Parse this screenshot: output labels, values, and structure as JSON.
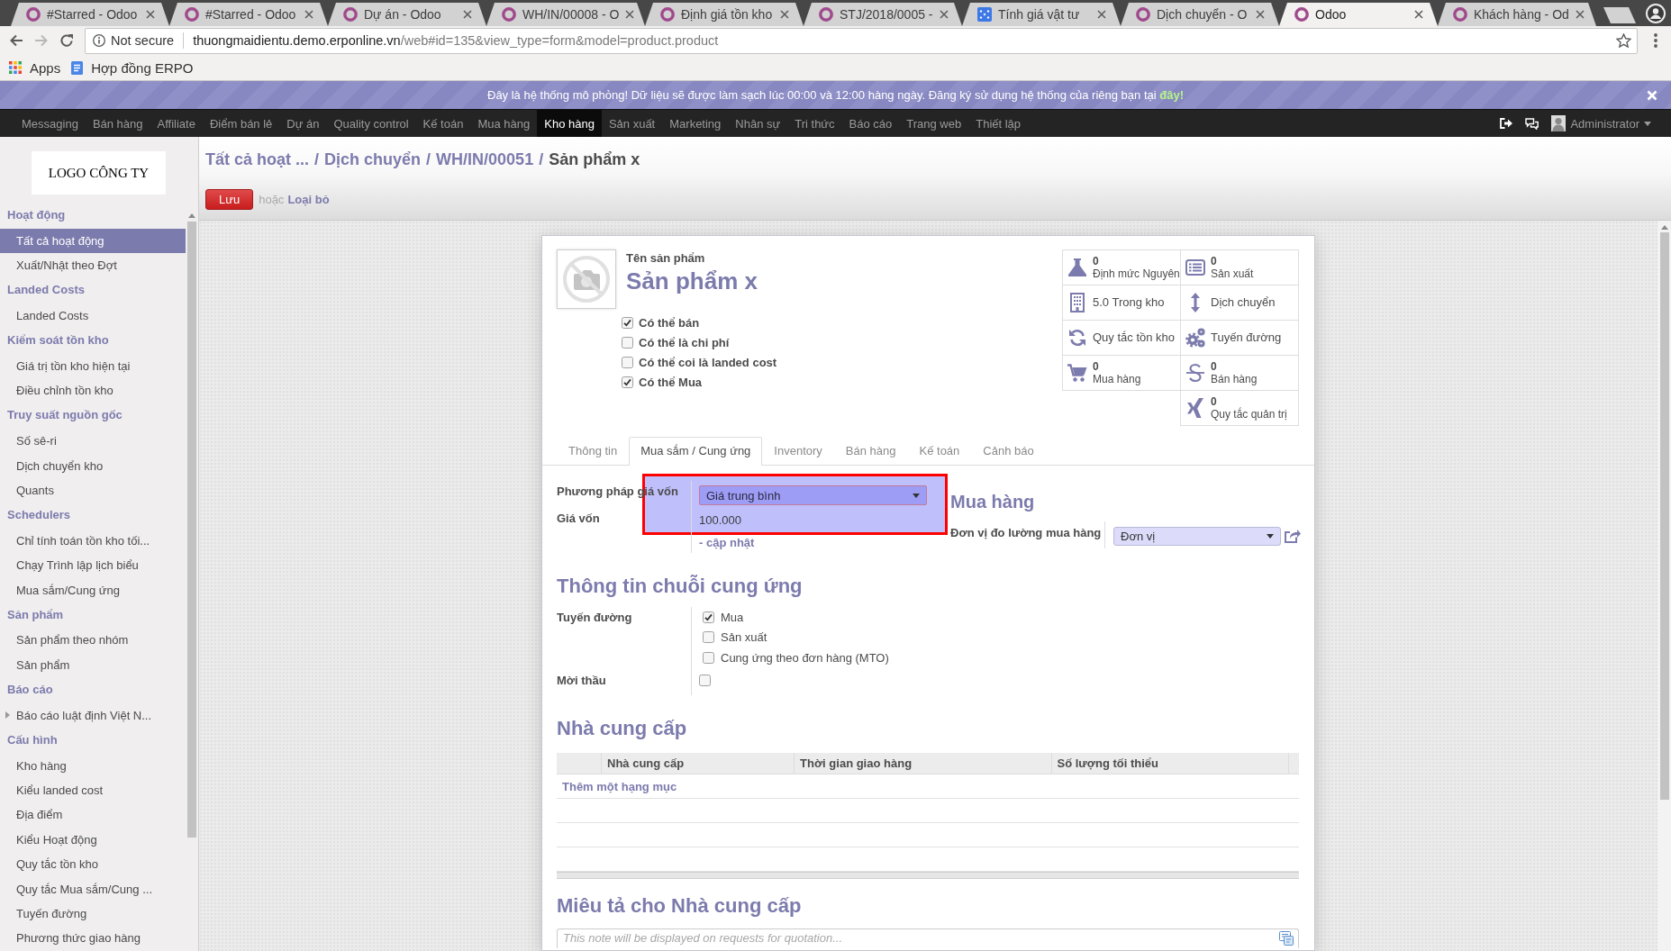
{
  "browser": {
    "tabs": [
      {
        "title": "#Starred - Odoo",
        "kind": "app",
        "selected": false
      },
      {
        "title": "#Starred - Odoo",
        "kind": "app",
        "selected": false
      },
      {
        "title": "Dự án - Odoo",
        "kind": "app",
        "selected": false
      },
      {
        "title": "WH/IN/00008 - O",
        "kind": "app",
        "selected": false
      },
      {
        "title": "Định giá tồn kho",
        "kind": "app",
        "selected": false
      },
      {
        "title": "STJ/2018/0005 -",
        "kind": "app",
        "selected": false
      },
      {
        "title": "Tính giá vật tư",
        "kind": "tool",
        "selected": false
      },
      {
        "title": "Dịch chuyển - O",
        "kind": "app",
        "selected": false
      },
      {
        "title": "Odoo",
        "kind": "app",
        "selected": true
      },
      {
        "title": "Khách hàng - Od",
        "kind": "app",
        "selected": false
      }
    ],
    "address": {
      "security": "Not secure",
      "host": "thuongmaidientu.demo.erponline.vn",
      "path": "/web#id=135&view_type=form&model=product.product"
    },
    "bookmarks": [
      {
        "label": "Apps",
        "kind": "apps"
      },
      {
        "label": "Hợp đồng ERPO",
        "kind": "page"
      }
    ]
  },
  "banner": {
    "text": "Đây là hệ thống mô phỏng! Dữ liệu sẽ được làm sạch lúc 00:00 và 12:00 hàng ngày. Đăng ký sử dụng hệ thống của riêng bạn tại",
    "link": "đây!"
  },
  "menu": [
    {
      "label": "Messaging",
      "selected": false
    },
    {
      "label": "Bán hàng",
      "selected": false
    },
    {
      "label": "Affiliate",
      "selected": false
    },
    {
      "label": "Điểm bán lẻ",
      "selected": false
    },
    {
      "label": "Dự án",
      "selected": false
    },
    {
      "label": "Quality control",
      "selected": false
    },
    {
      "label": "Kế toán",
      "selected": false
    },
    {
      "label": "Mua hàng",
      "selected": false
    },
    {
      "label": "Kho hàng",
      "selected": true
    },
    {
      "label": "Sản xuất",
      "selected": false
    },
    {
      "label": "Marketing",
      "selected": false
    },
    {
      "label": "Nhân sự",
      "selected": false
    },
    {
      "label": "Tri thức",
      "selected": false
    },
    {
      "label": "Báo cáo",
      "selected": false
    },
    {
      "label": "Trang web",
      "selected": false
    },
    {
      "label": "Thiết lập",
      "selected": false
    }
  ],
  "user": {
    "name": "Administrator"
  },
  "sidebar": {
    "logo": "LOGO CÔNG TY",
    "sections": [
      {
        "title": "Hoạt động",
        "items": [
          {
            "label": "Tất cả hoạt động",
            "selected": true
          },
          {
            "label": "Xuất/Nhật theo Đợt",
            "selected": false
          }
        ]
      },
      {
        "title": "Landed Costs",
        "items": [
          {
            "label": "Landed Costs",
            "selected": false
          }
        ]
      },
      {
        "title": "Kiểm soát tồn kho",
        "items": [
          {
            "label": "Giá trị tồn kho hiện tại",
            "selected": false
          },
          {
            "label": "Điều chỉnh tồn kho",
            "selected": false
          }
        ]
      },
      {
        "title": "Truy suất nguồn gốc",
        "items": [
          {
            "label": "Số sê-ri",
            "selected": false
          },
          {
            "label": "Dịch chuyển kho",
            "selected": false
          },
          {
            "label": "Quants",
            "selected": false
          }
        ]
      },
      {
        "title": "Schedulers",
        "items": [
          {
            "label": "Chỉ tính toán tồn kho tối...",
            "selected": false
          },
          {
            "label": "Chạy Trình lập lịch biểu",
            "selected": false
          },
          {
            "label": "Mua sắm/Cung ứng",
            "selected": false
          }
        ]
      },
      {
        "title": "Sản phẩm",
        "items": [
          {
            "label": "Sản phẩm theo nhóm",
            "selected": false
          },
          {
            "label": "Sản phẩm",
            "selected": false
          }
        ]
      },
      {
        "title": "Báo cáo",
        "items": [
          {
            "label": "Báo cáo luật định Việt N...",
            "selected": false,
            "expanded": false
          }
        ]
      },
      {
        "title": "Cấu hình",
        "items": [
          {
            "label": "Kho hàng",
            "selected": false
          },
          {
            "label": "Kiểu landed cost",
            "selected": false
          },
          {
            "label": "Địa điểm",
            "selected": false
          },
          {
            "label": "Kiểu Hoạt động",
            "selected": false
          },
          {
            "label": "Quy tắc tồn kho",
            "selected": false
          },
          {
            "label": "Quy tắc Mua sắm/Cung ...",
            "selected": false
          },
          {
            "label": "Tuyến đường",
            "selected": false
          },
          {
            "label": "Phương thức giao hàng",
            "selected": false
          }
        ]
      }
    ]
  },
  "breadcrumbs": [
    {
      "kind": "link",
      "text": "Tất cả hoạt ..."
    },
    {
      "kind": "separator",
      "text": "/"
    },
    {
      "kind": "link",
      "text": "Dịch chuyển"
    },
    {
      "kind": "separator",
      "text": "/"
    },
    {
      "kind": "link",
      "text": "WH/IN/00051"
    },
    {
      "kind": "separator",
      "text": "/"
    },
    {
      "kind": "current",
      "text": "Sản phẩm x"
    }
  ],
  "actions": {
    "save": "Lưu",
    "or": "hoặc",
    "discard": "Loại bỏ"
  },
  "product": {
    "name_label": "Tên sản phẩm",
    "name": "Sản phẩm x",
    "options": [
      {
        "label": "Có thể bán",
        "checked": true
      },
      {
        "label": "Có thể là chi phí",
        "checked": false
      },
      {
        "label": "Có thể coi là landed cost",
        "checked": false
      },
      {
        "label": "Có thể Mua",
        "checked": true
      }
    ]
  },
  "smart_buttons": [
    {
      "kind": "counter",
      "count": "0",
      "label": "Định mức Nguyên"
    },
    {
      "kind": "counter",
      "count": "0",
      "label": "Sản xuất"
    },
    {
      "kind": "label",
      "label": "5.0 Trong kho"
    },
    {
      "kind": "label",
      "label": "Dịch chuyển"
    },
    {
      "kind": "label",
      "label": "Quy tắc tồn kho"
    },
    {
      "kind": "label",
      "label": "Tuyến đường"
    },
    {
      "kind": "counter",
      "count": "0",
      "label": "Mua hàng"
    },
    {
      "kind": "counter",
      "count": "0",
      "label": "Bán hàng"
    },
    {
      "kind": "counter",
      "count": "0",
      "label": "Quy tắc quản trị"
    }
  ],
  "tabs": [
    {
      "label": "Thông tin",
      "selected": false
    },
    {
      "label": "Mua sắm / Cung ứng",
      "selected": true
    },
    {
      "label": "Inventory",
      "selected": false
    },
    {
      "label": "Bán hàng",
      "selected": false
    },
    {
      "label": "Kế toán",
      "selected": false
    },
    {
      "label": "Cảnh báo",
      "selected": false
    }
  ],
  "costing": {
    "method": {
      "label": "Phương pháp giá vốn",
      "value": "Giá trung bình"
    },
    "cost": {
      "label": "Giá vốn",
      "value": "100.000",
      "action": "- cập nhật"
    }
  },
  "purchase": {
    "title": "Mua hàng",
    "uom": {
      "label": "Đơn vị đo lường mua hàng",
      "value": "Đơn vị"
    }
  },
  "supply_chain": {
    "title": "Thông tin chuỗi cung ứng",
    "routes": {
      "label": "Tuyến đường",
      "options": [
        {
          "label": "Mua",
          "checked": true
        },
        {
          "label": "Sản xuất",
          "checked": false
        },
        {
          "label": "Cung ứng theo đơn hàng (MTO)",
          "checked": false
        }
      ]
    },
    "tender": {
      "label": "Mời thầu",
      "checked": false
    }
  },
  "vendors": {
    "title": "Nhà cung cấp",
    "columns": [
      "Nhà cung cấp",
      "Thời gian giao hàng",
      "Số lượng tối thiểu"
    ],
    "add_link": "Thêm một hạng mục"
  },
  "vendor_note": {
    "title": "Miêu tả cho Nhà cung cấp",
    "placeholder": "This note will be displayed on requests for quotation..."
  }
}
